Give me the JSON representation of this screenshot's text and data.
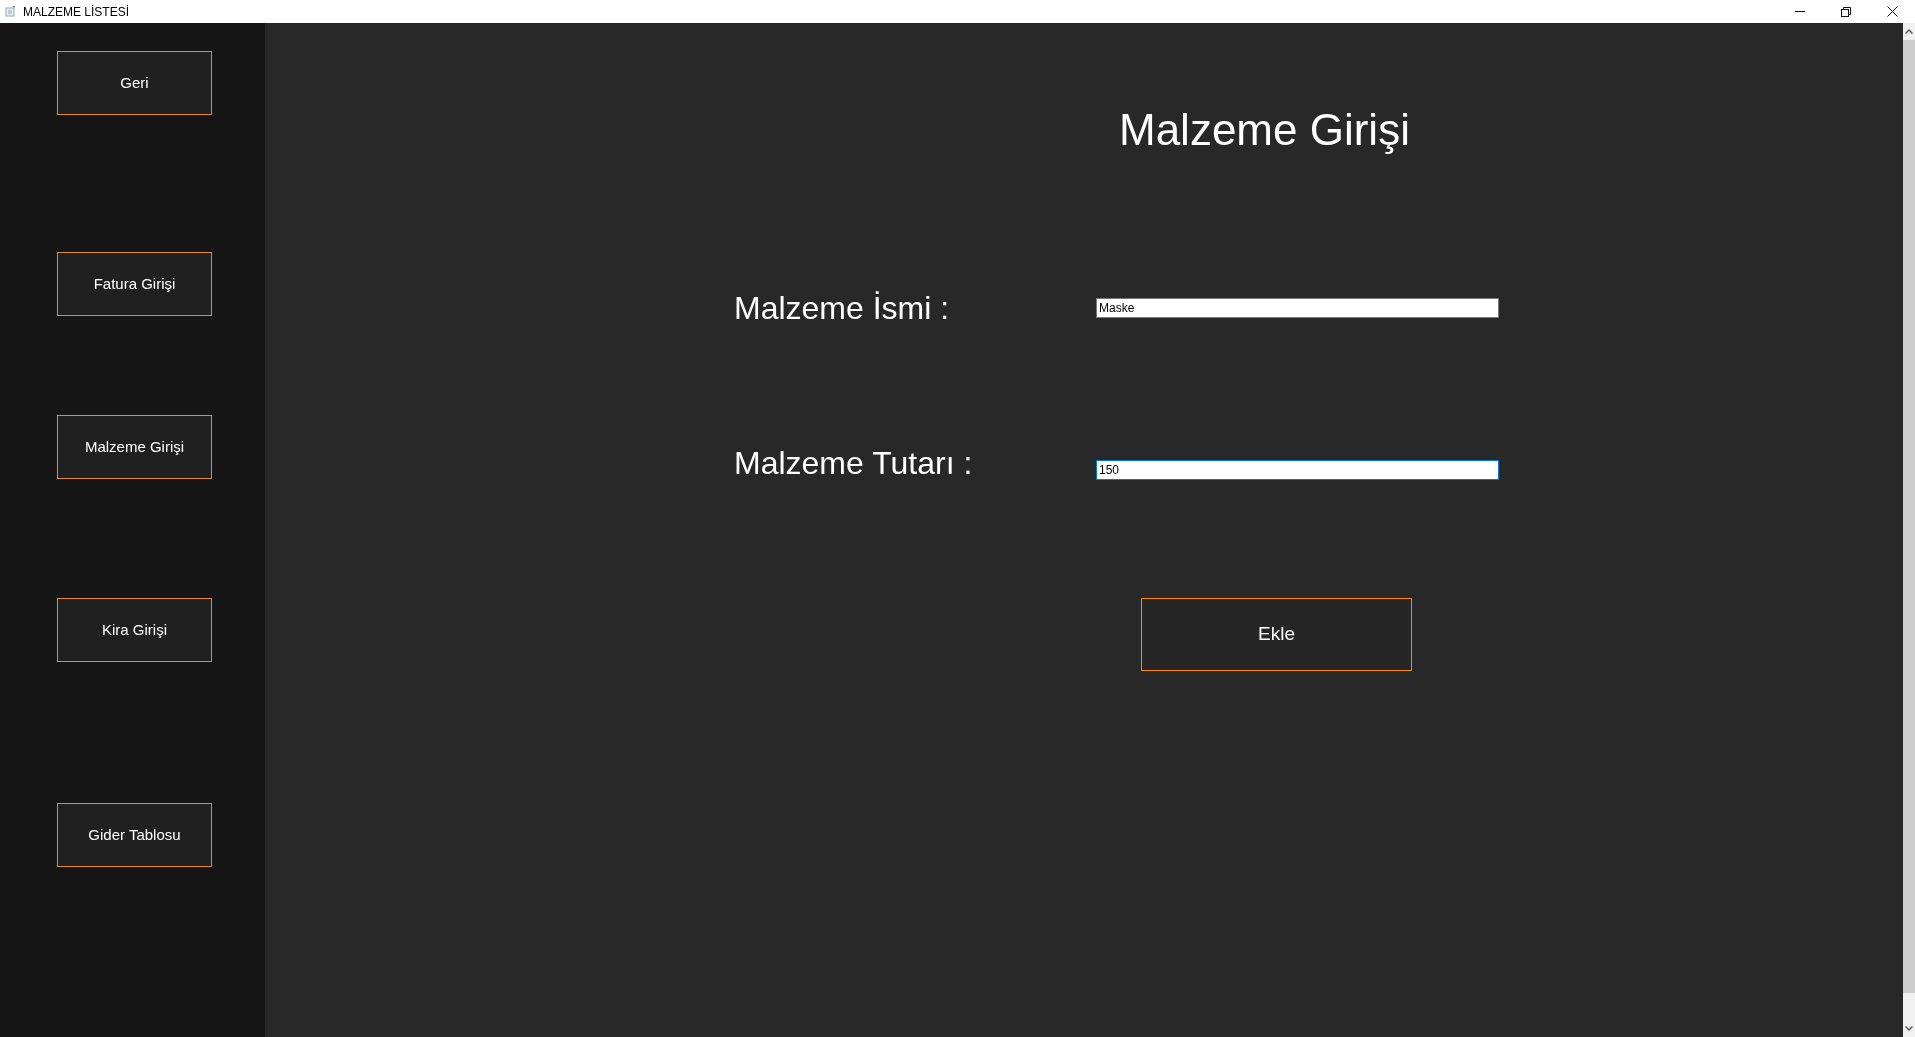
{
  "window": {
    "title": "MALZEME LİSTESİ"
  },
  "sidebar": {
    "buttons": [
      "Geri",
      "Fatura Girişi",
      "Malzeme Girişi",
      "Kira Girişi",
      "Gider Tablosu"
    ]
  },
  "heading": "Malzeme Girişi",
  "form": {
    "fields": [
      {
        "label": "Malzeme İsmi :",
        "value": "Maske",
        "focused": false
      },
      {
        "label": "Malzeme Tutarı :",
        "value": "150",
        "focused": true
      }
    ]
  },
  "submit_button": "Ekle"
}
